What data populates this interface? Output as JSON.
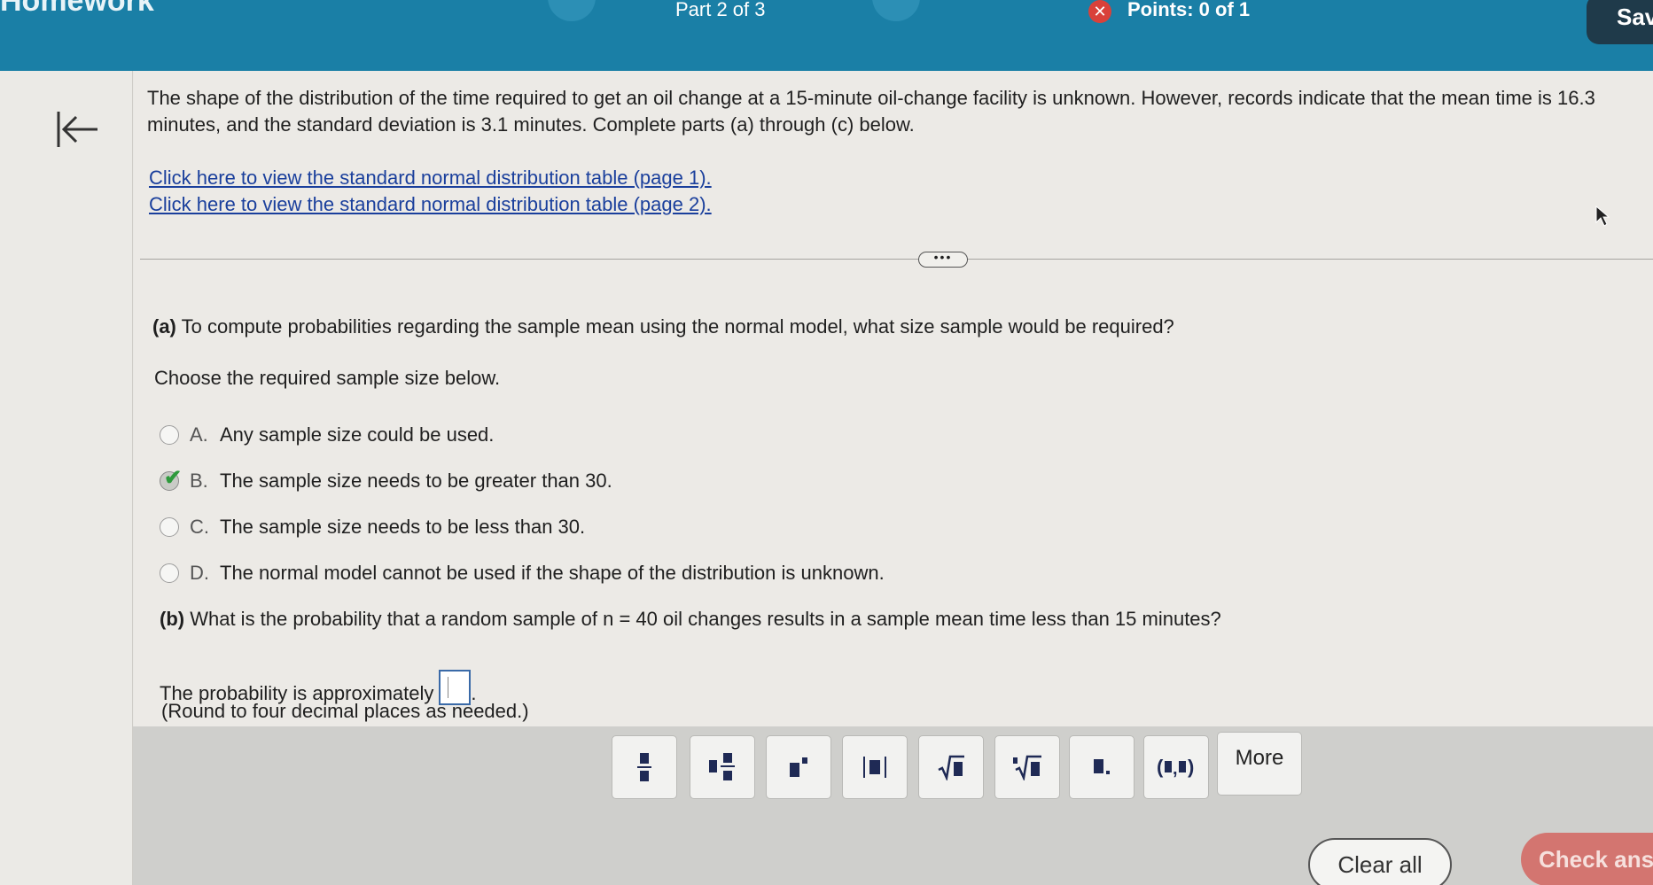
{
  "header": {
    "title": "Homework",
    "part": "Part 2 of 3",
    "points": "Points: 0 of 1",
    "save_label": "Sav"
  },
  "question": {
    "text": "The shape of the distribution of the time required to get an oil change at a 15-minute oil-change facility is unknown. However, records indicate that the mean time is 16.3 minutes, and the standard deviation is 3.1 minutes. Complete parts (a) through (c) below.",
    "link1": "Click here to view the standard normal distribution table (page 1).",
    "link2": "Click here to view the standard normal distribution table (page 2).",
    "dots": "•••"
  },
  "part_a": {
    "label": "(a)",
    "question": "To compute probabilities regarding the sample mean using the normal model, what size sample would be required?",
    "instruction": "Choose the required sample size below.",
    "options": [
      {
        "letter": "A.",
        "text": "Any sample size could be used."
      },
      {
        "letter": "B.",
        "text": "The sample size needs to be greater than 30."
      },
      {
        "letter": "C.",
        "text": "The sample size needs to be less than 30."
      },
      {
        "letter": "D.",
        "text": "The normal model cannot be used if the shape of the distribution is unknown."
      }
    ],
    "selected": "B."
  },
  "part_b": {
    "label": "(b)",
    "question": "What is the probability that a random sample of n = 40 oil changes results in a sample mean time less than 15 minutes?",
    "prob_prefix": "The probability is approximately",
    "prob_suffix": ".",
    "round_note": "(Round to four decimal places as needed.)"
  },
  "toolbar": {
    "buttons": [
      "fraction-icon",
      "mixed-number-icon",
      "exponent-icon",
      "absolute-value-icon",
      "square-root-icon",
      "nth-root-icon",
      "decimal-icon",
      "ordered-pair-icon"
    ],
    "more_label": "More"
  },
  "footer": {
    "clear_all": "Clear all",
    "check_answer": "Check ans"
  }
}
